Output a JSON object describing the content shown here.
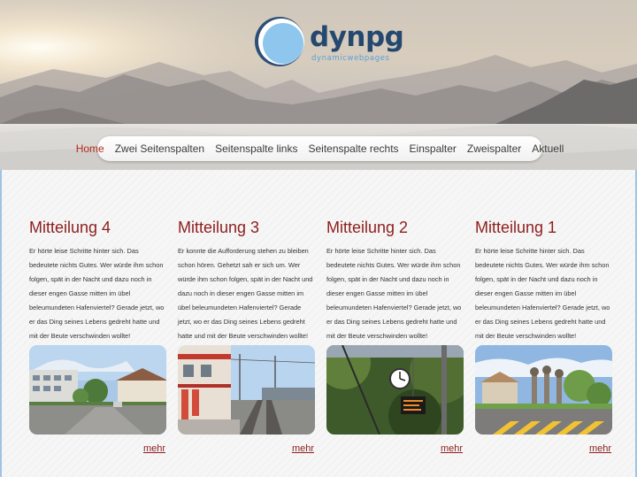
{
  "brand": {
    "name": "dynpg",
    "tagline": "dynamicwebpages"
  },
  "nav": [
    {
      "label": "Home",
      "active": true
    },
    {
      "label": "Zwei Seitenspalten",
      "active": false
    },
    {
      "label": "Seitenspalte links",
      "active": false
    },
    {
      "label": "Seitenspalte rechts",
      "active": false
    },
    {
      "label": "Einspalter",
      "active": false
    },
    {
      "label": "Zweispalter",
      "active": false
    },
    {
      "label": "Aktuell",
      "active": false
    }
  ],
  "cards": [
    {
      "title": "Mitteilung 4",
      "text": "Er hörte leise Schritte hinter sich. Das bedeutete nichts Gutes. Wer würde ihm schon folgen, spät in der Nacht und dazu noch in dieser engen Gasse mitten im übel beleumundeten Hafenviertel? Gerade jetzt, wo er das Ding seines Lebens gedreht hatte und mit der Beute verschwinden wollte!",
      "more": "mehr",
      "image": "street-scene"
    },
    {
      "title": "Mitteilung 3",
      "text": "Er konnte die Aufforderung stehen zu bleiben schon hören. Gehetzt sah er sich um. Wer würde ihm schon folgen, spät in der Nacht und dazu noch in dieser engen Gasse mitten im übel beleumundeten Hafenviertel? Gerade jetzt, wo er das Ding seines Lebens gedreht hatte und mit der Beute verschwinden wollte!",
      "more": "mehr",
      "image": "train-station"
    },
    {
      "title": "Mitteilung 2",
      "text": "Er hörte leise Schritte hinter sich. Das bedeutete nichts Gutes. Wer würde ihm schon folgen, spät in der Nacht und dazu noch in dieser engen Gasse mitten im übel beleumundeten Hafenviertel? Gerade jetzt, wo er das Ding seines Lebens gedreht hatte und mit der Beute verschwinden wollte!",
      "more": "mehr",
      "image": "station-clock"
    },
    {
      "title": "Mitteilung 1",
      "text": "Er hörte leise Schritte hinter sich. Das bedeutete nichts Gutes. Wer würde ihm schon folgen, spät in der Nacht und dazu noch in dieser engen Gasse mitten im übel beleumundeten Hafenviertel? Gerade jetzt, wo er das Ding seines Lebens gedreht hatte und mit der Beute verschwinden wollte!",
      "more": "mehr",
      "image": "roundabout"
    }
  ],
  "colors": {
    "accent": "#8e1d1d",
    "nav_active": "#b12b1c",
    "logo_dark": "#24486f",
    "logo_light": "#5a9fd6",
    "frame": "#9fc4e4"
  }
}
